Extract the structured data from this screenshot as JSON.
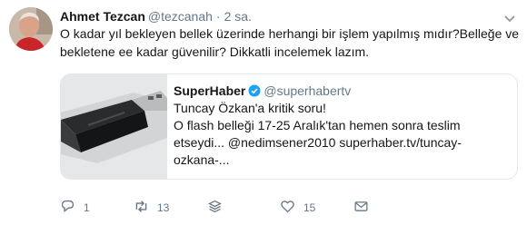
{
  "tweet": {
    "author_name": "Ahmet Tezcan",
    "author_handle": "@tezcanah",
    "separator": "·",
    "time": "2 sa.",
    "text_lines": [
      "O kadar yıl bekleyen bellek üzerinde herhangi bir işlem yapılmış mıdır?Belleğe ve",
      "bekletene ee kadar güvenilir?  Dikkatli incelemek lazım."
    ]
  },
  "quoted": {
    "author_name": "SuperHaber",
    "author_handle": "@superhabertv",
    "verified_icon": "verified-badge-icon",
    "lines": [
      "Tuncay Özkan'a kritik soru!",
      "O flash belleği 17-25 Aralık'tan hemen sonra teslim",
      "etseydi... @nedimsener2010 superhaber.tv/tuncay-",
      "ozkana-..."
    ],
    "image": "usb-flash-drive-photo"
  },
  "actions": {
    "reply_count": "1",
    "retweet_count": "13",
    "like_count": "15"
  },
  "colors": {
    "text": "#14171a",
    "secondary": "#657786",
    "border": "#e1e8ed",
    "verified": "#1da1f2"
  },
  "icons": [
    "more-caret-icon",
    "reply-icon",
    "retweet-icon",
    "stack-icon",
    "like-icon",
    "mail-icon"
  ]
}
